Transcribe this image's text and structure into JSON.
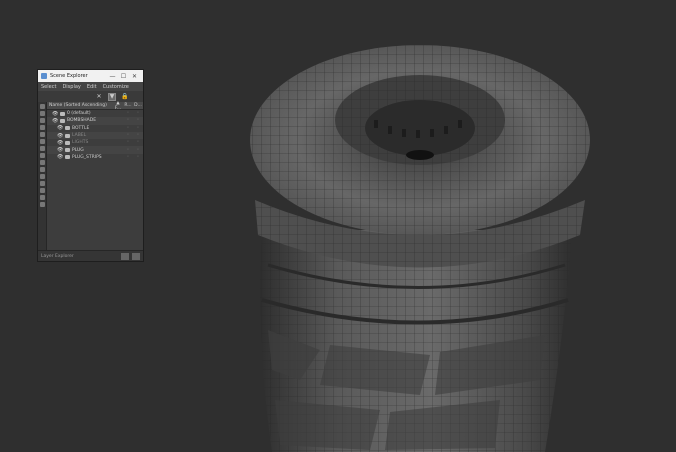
{
  "window": {
    "title": "Scene Explorer",
    "controls": {
      "minimize": "—",
      "maximize": "☐",
      "close": "✕"
    }
  },
  "menu": [
    "Select",
    "Display",
    "Edit",
    "Customize"
  ],
  "toolbar": {
    "filter": "▼",
    "lock": "🔒",
    "clear": "✕"
  },
  "columns": {
    "name": "Name (Sorted Ascending)",
    "col1": "▲ F...",
    "col2": "R...",
    "col3": "D..."
  },
  "tree": [
    {
      "label": "0 (default)",
      "indent": 1,
      "dim": false
    },
    {
      "label": "BOMBSHADE",
      "indent": 1,
      "dim": false
    },
    {
      "label": "BOTTLE",
      "indent": 2,
      "dim": false
    },
    {
      "label": "LABEL",
      "indent": 2,
      "dim": true
    },
    {
      "label": "LIGHTS",
      "indent": 2,
      "dim": true
    },
    {
      "label": "PLUG",
      "indent": 2,
      "dim": false
    },
    {
      "label": "PLUG_STRIPS",
      "indent": 2,
      "dim": false
    }
  ],
  "status": {
    "text": "Layer Explorer"
  },
  "colors": {
    "background": "#2f2f2f",
    "mesh": "#5c5c5c",
    "wire": "#2a2a2a"
  }
}
